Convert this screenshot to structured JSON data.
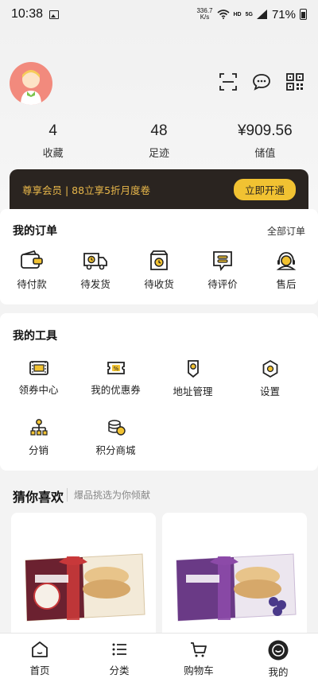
{
  "status_bar": {
    "time": "10:38",
    "net_speed_value": "336.7",
    "net_speed_unit": "K/s",
    "hd": "HD",
    "signal": "5G",
    "battery": "71%"
  },
  "header": {
    "stats": [
      {
        "value": "4",
        "label": "收藏"
      },
      {
        "value": "48",
        "label": "足迹"
      },
      {
        "value": "¥909.56",
        "label": "储值"
      }
    ]
  },
  "vip": {
    "text": "尊享会员 | 88立享5折月度卷",
    "button": "立即开通"
  },
  "orders": {
    "title": "我的订单",
    "all_link": "全部订单",
    "items": [
      {
        "label": "待付款",
        "icon": "wallet-icon"
      },
      {
        "label": "待发货",
        "icon": "truck-icon"
      },
      {
        "label": "待收货",
        "icon": "package-clock-icon"
      },
      {
        "label": "待评价",
        "icon": "comment-icon"
      },
      {
        "label": "售后",
        "icon": "headset-icon"
      }
    ]
  },
  "tools": {
    "title": "我的工具",
    "items": [
      {
        "label": "领券中心",
        "icon": "coupon-center-icon"
      },
      {
        "label": "我的优惠券",
        "icon": "coupon-icon"
      },
      {
        "label": "地址管理",
        "icon": "location-icon"
      },
      {
        "label": "设置",
        "icon": "gear-icon"
      },
      {
        "label": "分销",
        "icon": "distribution-icon"
      },
      {
        "label": "积分商城",
        "icon": "points-mall-icon"
      }
    ]
  },
  "guess": {
    "title": "猜你喜欢",
    "subtitle": "爆品挑选为你倾献"
  },
  "tabbar": {
    "items": [
      {
        "label": "首页",
        "icon": "home-icon"
      },
      {
        "label": "分类",
        "icon": "list-icon"
      },
      {
        "label": "购物车",
        "icon": "cart-icon"
      },
      {
        "label": "我的",
        "icon": "profile-icon"
      }
    ]
  },
  "colors": {
    "accent": "#f1c232",
    "vip_bg": "#2a2420",
    "vip_text": "#e8b74a",
    "avatar_bg": "#f28a7d"
  }
}
